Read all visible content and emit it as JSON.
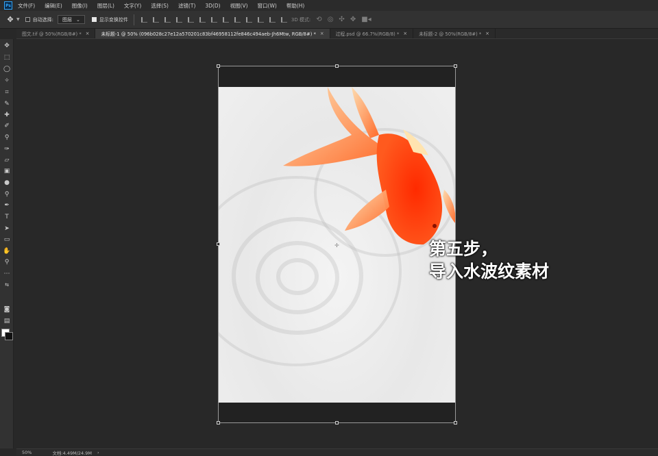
{
  "app_logo": "Ps",
  "menu": [
    "文件(F)",
    "编辑(E)",
    "图像(I)",
    "图层(L)",
    "文字(Y)",
    "选择(S)",
    "滤镜(T)",
    "3D(D)",
    "视图(V)",
    "窗口(W)",
    "帮助(H)"
  ],
  "options": {
    "auto_select_label": "自动选择:",
    "auto_select_checked": false,
    "target_value": "图层",
    "show_transform_label": "显示变换控件",
    "show_transform_checked": true,
    "mode_3d_label": "3D 模式:"
  },
  "tabs": [
    {
      "label": "图文.tif @ 50%(RGB/8#) *",
      "active": false
    },
    {
      "label": "未标题-1 @ 50% (096b028c27e12a570201c83bf46958112fe846c494aeb-Jh6Mtw, RGB/8#) *",
      "active": true
    },
    {
      "label": "过程.psd @ 66.7%(RGB/8) *",
      "active": false
    },
    {
      "label": "未标题-2 @ 50%(RGB/8#) *",
      "active": false
    }
  ],
  "tab_close": "×",
  "caption": {
    "line1": "第五步，",
    "line2": "导入水波纹素材"
  },
  "status": {
    "zoom": "50%",
    "doc_info": "文档:4.49M/24.9M",
    "arrow": "›"
  },
  "colors": {
    "accent": "#31a8ff",
    "fish": "#ff3b12",
    "foreground": "#ffffff",
    "background": "#111111"
  },
  "tools": [
    "move-icon",
    "marquee-icon",
    "lasso-icon",
    "magic-wand-icon",
    "crop-icon",
    "eyedropper-icon",
    "healing-icon",
    "brush-icon",
    "stamp-icon",
    "history-brush-icon",
    "eraser-icon",
    "gradient-icon",
    "blur-icon",
    "dodge-icon",
    "pen-icon",
    "type-icon",
    "path-select-icon",
    "rectangle-icon",
    "hand-icon",
    "zoom-icon",
    "more-icon"
  ]
}
